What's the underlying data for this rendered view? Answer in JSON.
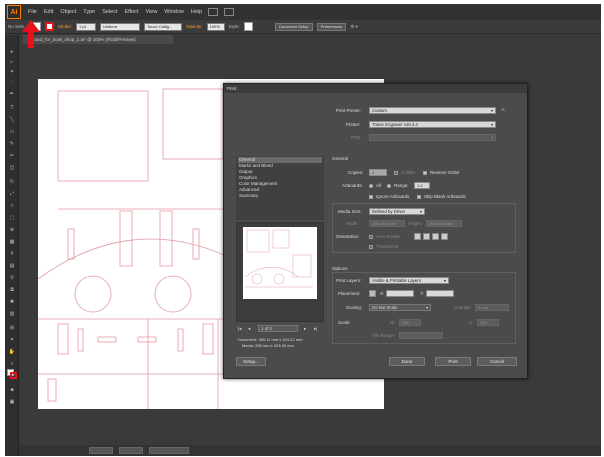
{
  "menu": {
    "logo": "Ai",
    "items": [
      "File",
      "Edit",
      "Object",
      "Type",
      "Select",
      "Effect",
      "View",
      "Window",
      "Help"
    ]
  },
  "control": {
    "selection": "No Sele...",
    "stroke_label": "Stroke:",
    "stroke_value": "1 pt",
    "uniform": "Uniform",
    "brush": "Touch Callig...",
    "opacity_label": "Opacity:",
    "opacity_value": "100%",
    "style_label": "Style:",
    "doc_setup": "Document Setup",
    "preferences": "Preferences"
  },
  "document_tab": "board_for_bowl_shop_2.ai* @ 100% (RGB/Preview)",
  "dialog": {
    "title": "Print",
    "print_preset_label": "Print Preset:",
    "print_preset_value": "Custom",
    "printer_label": "Printer:",
    "printer_value": "Trotec Engraver v10.4.4",
    "ppd_label": "PPD:",
    "categories": [
      "General",
      "Marks and Bleed",
      "Output",
      "Graphics",
      "Color Management",
      "Advanced",
      "Summary"
    ],
    "selected_category": "General",
    "general_header": "General",
    "copies_label": "Copies:",
    "copies_value": "1",
    "collate": "Collate",
    "reverse_order": "Reverse Order",
    "artboards_label": "Artboards:",
    "all": "All",
    "range": "Range:",
    "range_value": "1-2",
    "ignore_artboards": "Ignore Artboards",
    "skip_blank": "Skip Blank Artboards",
    "media_size_label": "Media Size:",
    "media_size_value": "Defined by Driver",
    "width_label": "Width:",
    "width_value": "285.2014 mm",
    "height_label": "Height:",
    "height_value": "203.2004 mm",
    "orientation_label": "Orientation:",
    "auto_rotate": "Auto-Rotate",
    "transverse": "Transverse",
    "options_header": "Options",
    "print_layers_label": "Print Layers:",
    "print_layers_value": "Visible & Printable Layers",
    "placement_label": "Placement:",
    "x_label": "X:",
    "y_label": "Y:",
    "scaling_label": "Scaling:",
    "scaling_value": "Do Not Scale",
    "overlap_label": "Overlap:",
    "overlap_value": "0 mm",
    "scale_label": "Scale:",
    "w_label": "W:",
    "w_value": "100",
    "h_label": "H:",
    "h_value": "100",
    "tile_range_label": "Tile Range:",
    "page_indicator": "1 of 2",
    "doc_info_1": "Document: 285.11 mm x 204.22 mm",
    "doc_info_2": "Media: 285 mm x 203.20 mm",
    "setup_button": "Setup...",
    "done_button": "Done",
    "print_button": "Print",
    "cancel_button": "Cancel"
  },
  "colors": {
    "accent": "#ff7c00",
    "cut_line": "#e39aa3",
    "arrow": "#e8121c"
  }
}
